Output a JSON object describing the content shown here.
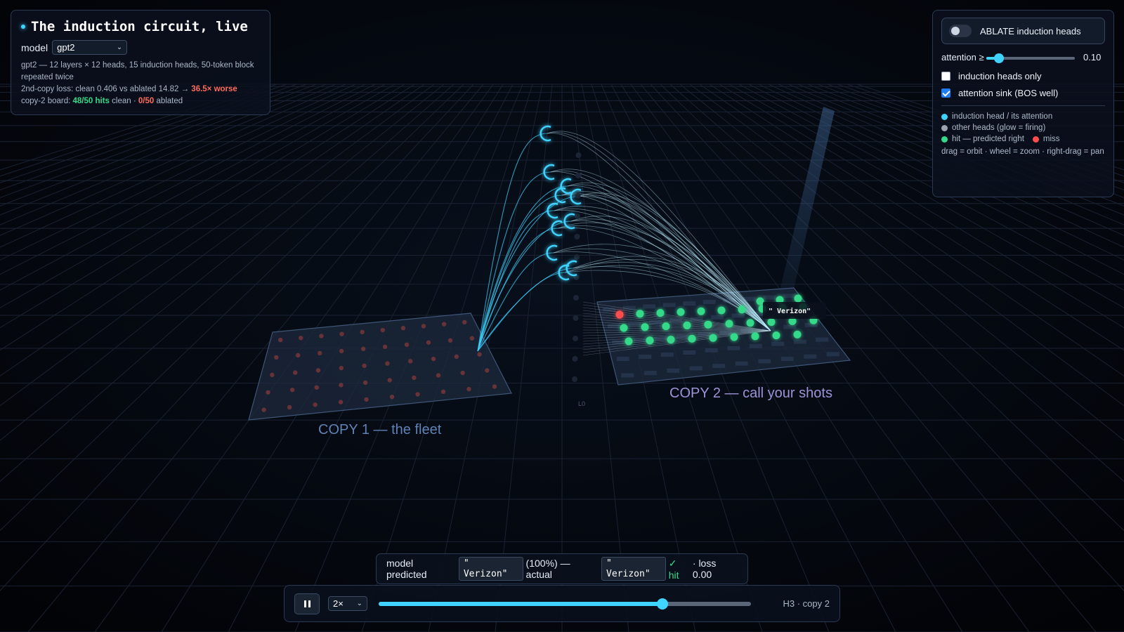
{
  "info": {
    "title": "The induction circuit, live",
    "model_label": "model",
    "model_value": "gpt2",
    "desc_line1": "gpt2 — 12 layers × 12 heads, 15 induction heads, 50-token block repeated twice",
    "loss_prefix": "2nd-copy loss: clean 0.406 vs ablated 14.82 → ",
    "loss_ratio": "36.5× worse",
    "board_prefix": "copy-2 board: ",
    "board_clean": "48/50 hits",
    "board_mid": " clean · ",
    "board_ablated": "0/50",
    "board_suffix": " ablated"
  },
  "controls": {
    "ablate_label": "ABLATE induction heads",
    "ablate_on": false,
    "attention_label": "attention ≥",
    "attention_value": "0.10",
    "attention_fraction": 0.1,
    "induction_only_label": "induction heads only",
    "induction_only_checked": false,
    "sink_label": "attention sink (BOS well)",
    "sink_checked": true,
    "legend": [
      {
        "label": "induction head / its attention",
        "color": "#3fd3ff"
      },
      {
        "label": "other heads (glow = firing)",
        "color": "#9aa3ae"
      },
      {
        "label": "hit — predicted right",
        "color": "#35d98a"
      },
      {
        "label": "miss",
        "color": "#ff4d4d"
      }
    ],
    "hint": "drag = orbit · wheel = zoom · right-drag = pan"
  },
  "scene": {
    "copy1_label": "COPY 1 — the fleet",
    "copy2_label": "COPY 2 — call your shots",
    "layer_label": "L0",
    "token_callout": "\" Verizon\"",
    "colors": {
      "induction": "#3fd3ff",
      "hit": "#35d98a",
      "miss": "#ff4d4d",
      "grid": "#1a2233"
    }
  },
  "prediction": {
    "prefix": "model predicted",
    "predicted_token": "\" Verizon\"",
    "prob": "(100%) — actual",
    "actual_token": "\" Verizon\"",
    "hit": "✓ hit",
    "loss": "· loss 0.00"
  },
  "playback": {
    "speed": "2×",
    "progress": 0.77,
    "step_label": "H3 · copy 2"
  }
}
